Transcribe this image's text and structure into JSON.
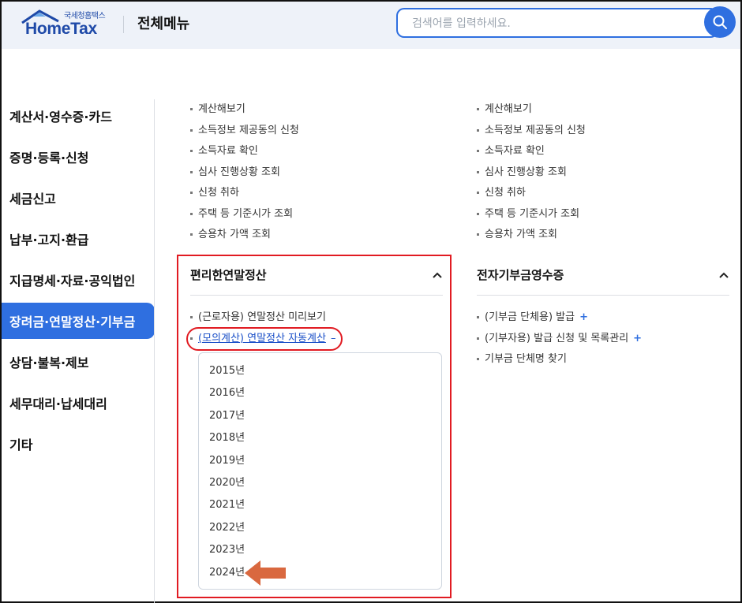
{
  "header": {
    "logo_small": "국세청홈택스",
    "logo_main": "HomeTax",
    "title": "전체메뉴",
    "search_placeholder": "검색어를 입력하세요."
  },
  "sidebar": {
    "items": [
      {
        "label": "계산서·영수증·카드"
      },
      {
        "label": "증명·등록·신청"
      },
      {
        "label": "세금신고"
      },
      {
        "label": "납부·고지·환급"
      },
      {
        "label": "지급명세·자료·공익법인"
      },
      {
        "label": "장려금·연말정산·기부금",
        "active": true
      },
      {
        "label": "상담·불복·제보"
      },
      {
        "label": "세무대리·납세대리"
      },
      {
        "label": "기타"
      }
    ]
  },
  "left_column": {
    "top_links": [
      "계산해보기",
      "소득정보 제공동의 신청",
      "소득자료 확인",
      "심사 진행상황 조회",
      "신청 취하",
      "주택 등 기준시가 조회",
      "승용차 가액 조회"
    ],
    "section": {
      "title": "편리한연말정산",
      "link1": "(근로자용) 연말정산 미리보기",
      "link2": "(모의계산) 연말정산 자동계산",
      "link2_toggle": "–",
      "years": [
        "2015년",
        "2016년",
        "2017년",
        "2018년",
        "2019년",
        "2020년",
        "2021년",
        "2022년",
        "2023년",
        "2024년"
      ]
    }
  },
  "right_column": {
    "top_links": [
      "계산해보기",
      "소득정보 제공동의 신청",
      "소득자료 확인",
      "심사 진행상황 조회",
      "신청 취하",
      "주택 등 기준시가 조회",
      "승용차 가액 조회"
    ],
    "section": {
      "title": "전자기부금영수증",
      "links": [
        {
          "label": "(기부금 단체용) 발급",
          "toggle": "+"
        },
        {
          "label": "(기부자용) 발급 신청 및 목록관리",
          "toggle": "+"
        },
        {
          "label": "기부금 단체명 찾기",
          "toggle": ""
        }
      ]
    }
  },
  "colors": {
    "accent": "#2f6fe0",
    "highlight": "#e11b22",
    "arrow": "#d9683f"
  }
}
